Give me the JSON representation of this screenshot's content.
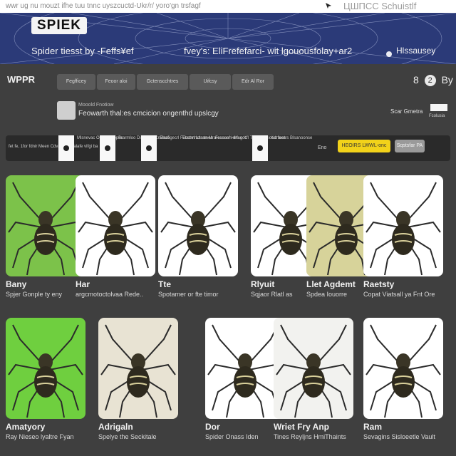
{
  "top_bar": {
    "left_text": "wwr ug nu mouzt ifhe tuu tnnc uyszcuctd-Ukr/r/ yoro'gn trsfagf",
    "right_text": "ЦШПСС Schuistlf"
  },
  "banner": {
    "logo": "SPIEK",
    "tagline_left": "Spider tiesst by -Feffs¥ef",
    "tagline_mid": "fvey's: EliFrefefarci- wit lgouousfolay+ar2",
    "tagline_right": "Hlssausey"
  },
  "nav": {
    "brand": "WPPR",
    "tabs": [
      "Fegfficey",
      "Feoor aloi",
      "Gctenscchtres",
      "Uifcsy",
      "Edr Al Ror"
    ],
    "user_count": "8",
    "user_initial": "2",
    "user_name": "By"
  },
  "promo": {
    "small": "Mooold Fnotiow",
    "text": "Feowarth thal:es cmcicion ongenthd upslcgy",
    "right": "Scar Gmetra",
    "flag_caption": "Fcolusia"
  },
  "filters": {
    "info": "fet fe, 1for fdnir Meen Cdvarer dimalafe vIfgi ba",
    "items": [
      {
        "label": "Mlsnevac Ogoin ftoppes"
      },
      {
        "label": "Brarmloo Diprie fla Cralaco"
      },
      {
        "label": "Ellulfigecrl Fxtatnrl Lzsstnea"
      },
      {
        "label": "Eoctotratlsan Mrarecouef Hlle uoc"
      },
      {
        "label": "Fcssaon-orfag Kfl Tnacrtn Bloecrfaes"
      },
      {
        "label": "Kdt leotrs Blsanoonse"
      }
    ],
    "count": "Eno",
    "primary_button": "HEOIRS LWWL-onc",
    "secondary_button": "Sqstsfar PA"
  },
  "cards": [
    {
      "name": "Bany",
      "desc": "Spjer Gonple ty eny",
      "bg": "#7cc24a"
    },
    {
      "name": "Har",
      "desc": "argcmotoctolvaa Rede..",
      "bg": "#ffffff"
    },
    {
      "name": "Tte",
      "desc": "Spotamer or fte timor",
      "bg": "#ffffff"
    },
    {
      "name": "Rlyuit",
      "desc": "Sqjaor Rlatl as",
      "bg": "#ffffff"
    },
    {
      "name": "Llet Agdemt",
      "desc": "Spdea Iouorre",
      "bg": "#d7d39a"
    },
    {
      "name": "Raetsty",
      "desc": "Copat Viatsall ya Fnt Ore",
      "bg": "#ffffff"
    },
    {
      "name": "Amatyory",
      "desc": "Ray Nieseo lyaltre Fyan",
      "bg": "#6fcf3f"
    },
    {
      "name": "Adrigaln",
      "desc": "Spelye the Seckitale",
      "bg": "#e8e3d3"
    },
    {
      "name": "Dor",
      "desc": "Spider Onass Iden",
      "bg": "#ffffff"
    },
    {
      "name": "Wriet Fry Anp",
      "desc": "Tines Reyljns HmiThaints",
      "bg": "#f2f2ef"
    },
    {
      "name": "Ram",
      "desc": "Sevagins Sisloeetle Vault",
      "bg": "#ffffff"
    }
  ]
}
